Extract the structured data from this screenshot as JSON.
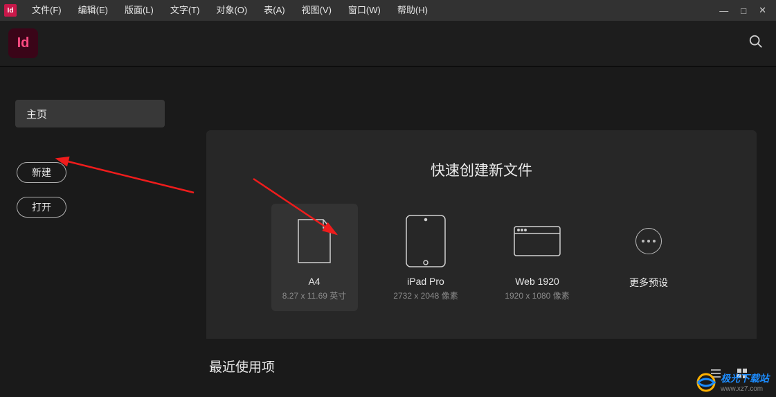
{
  "app": {
    "badge": "Id",
    "logo_text": "Id"
  },
  "menu": {
    "items": [
      "文件(F)",
      "编辑(E)",
      "版面(L)",
      "文字(T)",
      "对象(O)",
      "表(A)",
      "视图(V)",
      "窗口(W)",
      "帮助(H)"
    ]
  },
  "window_controls": {
    "minimize": "—",
    "maximize": "□",
    "close": "✕"
  },
  "sidebar": {
    "home_tab": "主页",
    "new_button": "新建",
    "open_button": "打开"
  },
  "main": {
    "panel_title": "快速创建新文件",
    "recent_title": "最近使用项",
    "presets": [
      {
        "name": "A4",
        "dim": "8.27 x 11.69 英寸",
        "icon": "page",
        "selected": true
      },
      {
        "name": "iPad Pro",
        "dim": "2732 x 2048 像素",
        "icon": "tablet",
        "selected": false
      },
      {
        "name": "Web 1920",
        "dim": "1920 x 1080 像素",
        "icon": "browser",
        "selected": false
      },
      {
        "name": "更多预设",
        "dim": "",
        "icon": "more",
        "selected": false
      }
    ]
  },
  "watermark": {
    "text": "极光下载站",
    "url": "www.xz7.com"
  }
}
